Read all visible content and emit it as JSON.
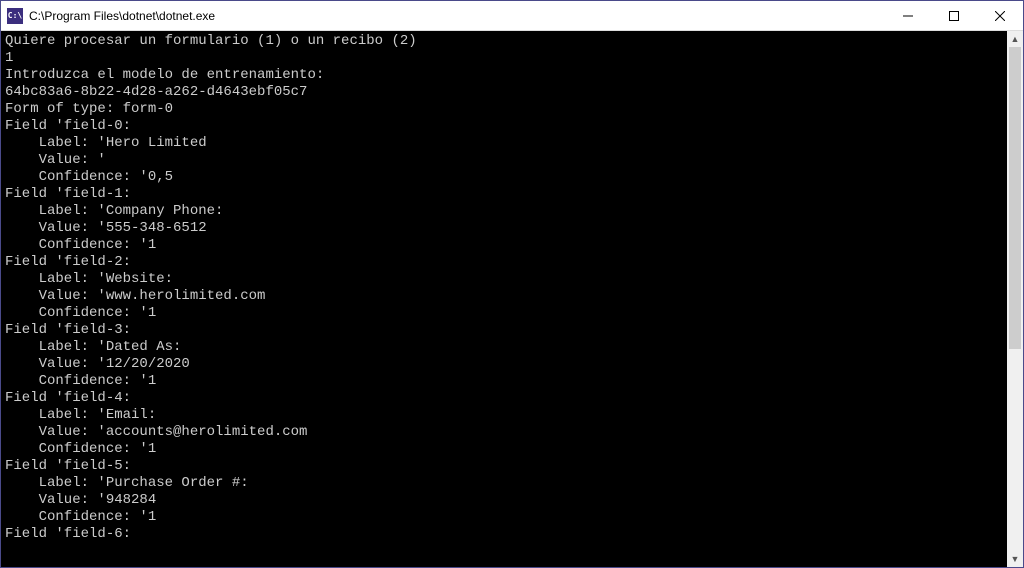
{
  "window": {
    "title": "C:\\Program Files\\dotnet\\dotnet.exe",
    "icon_label": "C:\\"
  },
  "terminal": {
    "prompt_question": "Quiere procesar un formulario (1) o un recibo (2)",
    "prompt_answer": "1",
    "model_prompt": "Introduzca el modelo de entrenamiento:",
    "model_id": "64bc83a6-8b22-4d28-a262-d4643ebf05c7",
    "form_type_line": "Form of type: form-0",
    "fields": [
      {
        "name": "field-0",
        "label": "Hero Limited",
        "value": "",
        "confidence": "0,5"
      },
      {
        "name": "field-1",
        "label": "Company Phone:",
        "value": "555-348-6512",
        "confidence": "1"
      },
      {
        "name": "field-2",
        "label": "Website:",
        "value": "www.herolimited.com",
        "confidence": "1"
      },
      {
        "name": "field-3",
        "label": "Dated As:",
        "value": "12/20/2020",
        "confidence": "1"
      },
      {
        "name": "field-4",
        "label": "Email:",
        "value": "accounts@herolimited.com",
        "confidence": "1"
      },
      {
        "name": "field-5",
        "label": "Purchase Order #:",
        "value": "948284",
        "confidence": "1"
      }
    ],
    "next_field_line": "Field 'field-6:"
  }
}
